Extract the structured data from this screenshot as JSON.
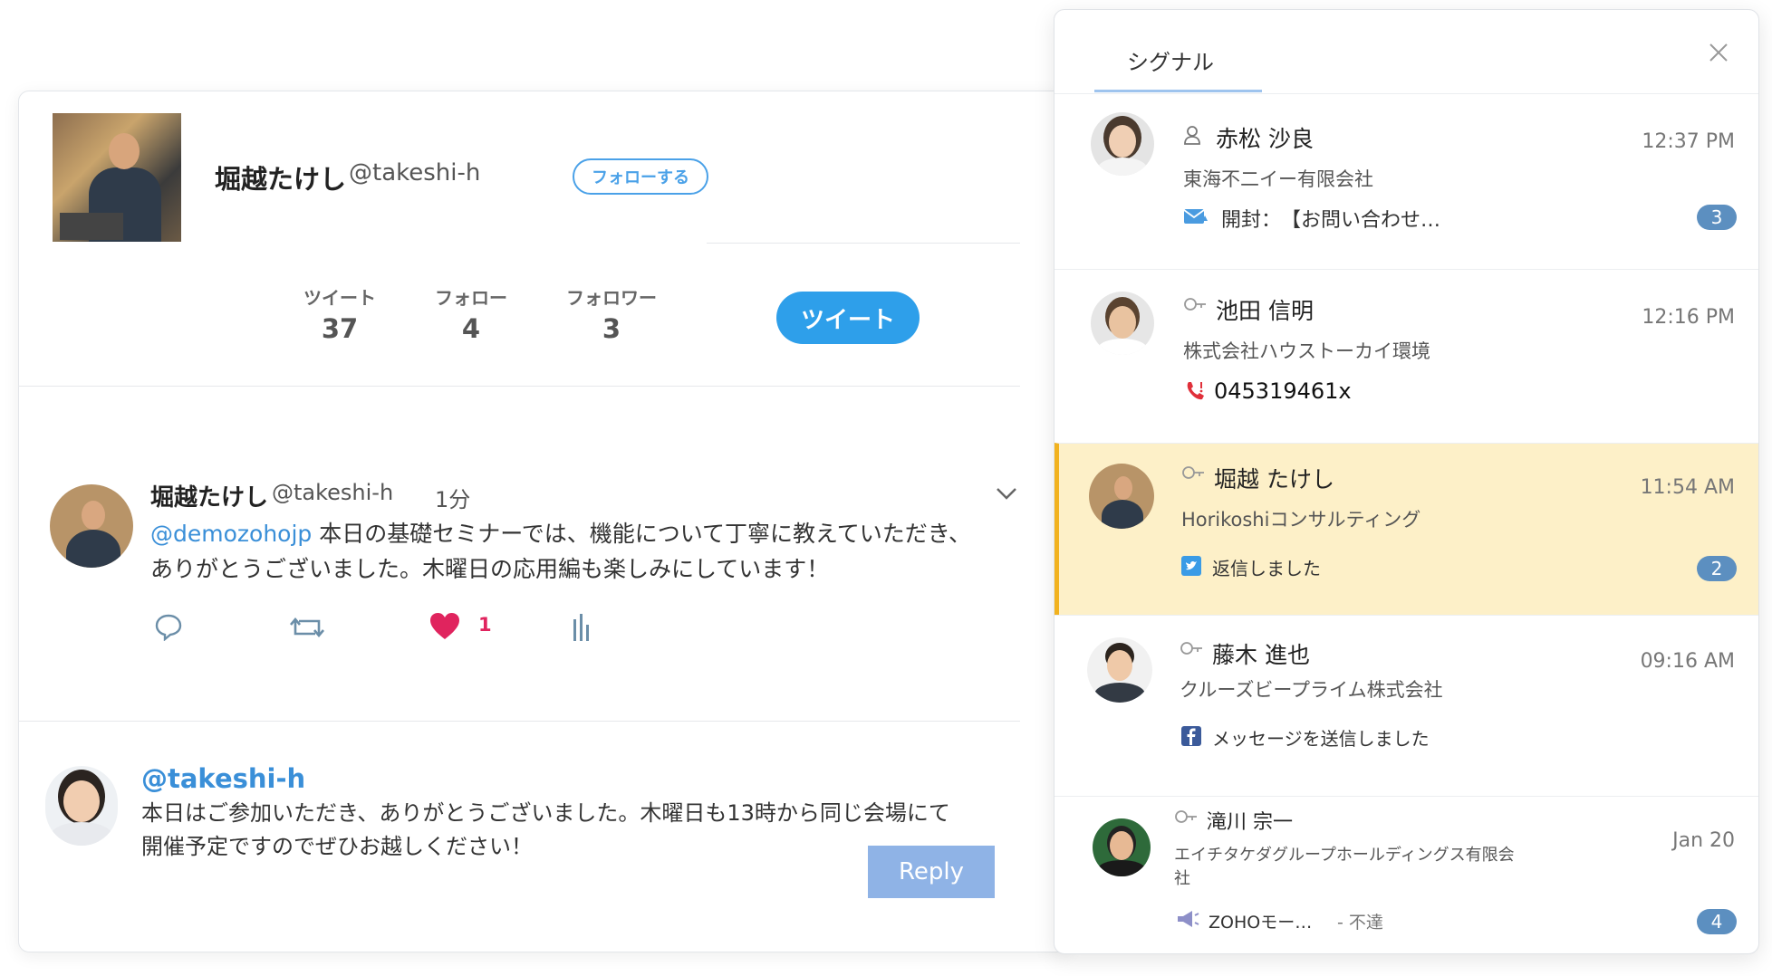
{
  "profile": {
    "name": "堀越たけし",
    "handle": "@takeshi-h",
    "follow_label": "フォローする",
    "stats": [
      {
        "label": "ツイート",
        "value": "37"
      },
      {
        "label": "フォロー",
        "value": "4"
      },
      {
        "label": "フォロワー",
        "value": "3"
      }
    ],
    "tweet_button": "ツイート"
  },
  "tweet": {
    "name": "堀越たけし",
    "handle": "@takeshi-h",
    "time": "1分",
    "mention": "@demozohojp",
    "text_line1": " 本日の基礎セミナーでは、機能について丁寧に教えていただき、",
    "text_line2": "ありがとうございました。木曜日の応用編も楽しみにしています！",
    "like_count": "1"
  },
  "reply": {
    "handle": "@takeshi-h",
    "text_line1": "本日はご参加いただき、ありがとうございました。木曜日も13時から同じ会場にて",
    "text_line2": "開催予定ですのでぜひお越しください！",
    "button": "Reply"
  },
  "panel": {
    "tab": "シグナル",
    "items": [
      {
        "name": "赤松 沙良",
        "company": "東海不二イー有限会社",
        "time": "12:37 PM",
        "message": "開封：　【お問い合わせ…",
        "badge": "3"
      },
      {
        "name": "池田 信明",
        "company": "株式会社ハウストーカイ環境",
        "time": "12:16 PM",
        "message": "045319461x",
        "badge": ""
      },
      {
        "name": "堀越 たけし",
        "company": "Horikoshiコンサルティング",
        "time": "11:54 AM",
        "message": "返信しました",
        "badge": "2"
      },
      {
        "name": "藤木 進也",
        "company": "クルーズビープライム株式会社",
        "time": "09:16 AM",
        "message": "メッセージを送信しました",
        "badge": ""
      },
      {
        "name": "滝川 宗一",
        "company_line1": "エイチタケダグループホールディングス有限会",
        "company_line2": "社",
        "time": "Jan 20",
        "message": "ZOHOモー…",
        "message_suffix": "- 不達",
        "badge": "4"
      }
    ]
  },
  "colors": {
    "twitter_blue": "#2e9fea",
    "highlight": "#fdf0c8",
    "highlight_border": "#f2b21e",
    "badge": "#5c8fc0",
    "like": "#e0245e"
  }
}
